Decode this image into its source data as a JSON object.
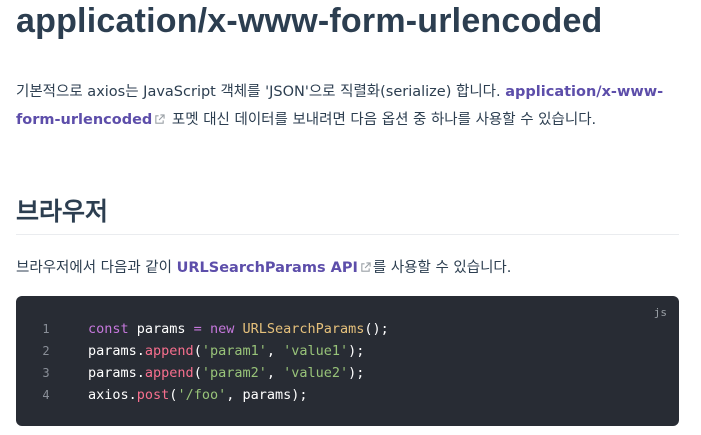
{
  "title": "application/x-www-form-urlencoded",
  "intro": {
    "text1": "기본적으로 axios는 JavaScript 객체를 'JSON'으로 직렬화(serialize) 합니다. ",
    "link_text": "application/x-www-form-urlencoded",
    "text2": " 포멧 대신 데이터를 보내려면 다음 옵션 중 하나를 사용할 수 있습니다."
  },
  "section": {
    "heading": "브라우저",
    "text1": "브라우저에서 다음과 같이 ",
    "link_text": "URLSearchParams API",
    "text2": "를 사용할 수 있습니다."
  },
  "code_block": {
    "language": "js",
    "line_numbers": [
      "1",
      "2",
      "3",
      "4"
    ],
    "lines": [
      [
        {
          "t": "const",
          "c": "kw"
        },
        {
          "t": " params ",
          "c": "pn"
        },
        {
          "t": "=",
          "c": "kw"
        },
        {
          "t": " ",
          "c": "pn"
        },
        {
          "t": "new",
          "c": "kw"
        },
        {
          "t": " ",
          "c": "pn"
        },
        {
          "t": "URLSearchParams",
          "c": "cls"
        },
        {
          "t": "();",
          "c": "pn"
        }
      ],
      [
        {
          "t": "params.",
          "c": "pn"
        },
        {
          "t": "append",
          "c": "fn"
        },
        {
          "t": "(",
          "c": "pn"
        },
        {
          "t": "'param1'",
          "c": "str"
        },
        {
          "t": ", ",
          "c": "pn"
        },
        {
          "t": "'value1'",
          "c": "str"
        },
        {
          "t": ");",
          "c": "pn"
        }
      ],
      [
        {
          "t": "params.",
          "c": "pn"
        },
        {
          "t": "append",
          "c": "fn"
        },
        {
          "t": "(",
          "c": "pn"
        },
        {
          "t": "'param2'",
          "c": "str"
        },
        {
          "t": ", ",
          "c": "pn"
        },
        {
          "t": "'value2'",
          "c": "str"
        },
        {
          "t": ");",
          "c": "pn"
        }
      ],
      [
        {
          "t": "axios.",
          "c": "pn"
        },
        {
          "t": "post",
          "c": "fn"
        },
        {
          "t": "(",
          "c": "pn"
        },
        {
          "t": "'/foo'",
          "c": "str"
        },
        {
          "t": ", params);",
          "c": "pn"
        }
      ]
    ]
  },
  "colors": {
    "link": "#5d4eaa",
    "code_bg": "#282c34",
    "text": "#2c3e50"
  },
  "icons": [
    "external-link-icon"
  ]
}
